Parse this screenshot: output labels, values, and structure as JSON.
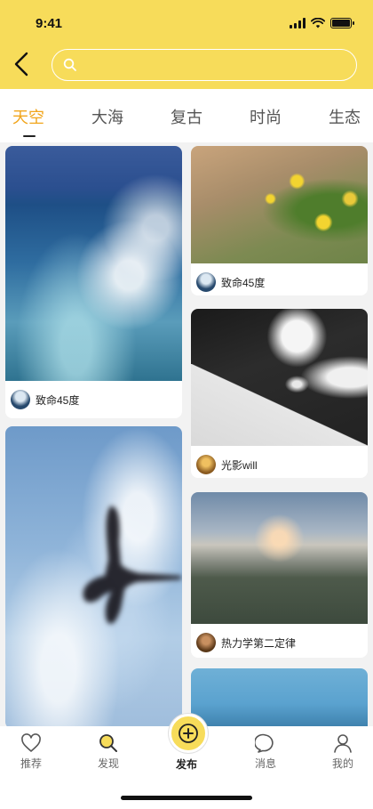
{
  "status_bar": {
    "time": "9:41"
  },
  "search": {
    "placeholder": "",
    "value": ""
  },
  "tabs": [
    {
      "label": "天空",
      "active": true
    },
    {
      "label": "大海",
      "active": false
    },
    {
      "label": "复古",
      "active": false
    },
    {
      "label": "时尚",
      "active": false
    },
    {
      "label": "生态",
      "active": false
    }
  ],
  "feed": {
    "left": [
      {
        "author": "致命45度",
        "photo": "ocean"
      },
      {
        "author": "",
        "photo": "sky-windmill"
      }
    ],
    "right": [
      {
        "author": "致命45度",
        "photo": "yellow-flowers"
      },
      {
        "author": "光影will",
        "photo": "building-clouds"
      },
      {
        "author": "热力学第二定律",
        "photo": "city-sunset"
      },
      {
        "author": "",
        "photo": "sea"
      }
    ]
  },
  "bottom_nav": {
    "items": [
      {
        "label": "推荐",
        "icon": "heart-icon"
      },
      {
        "label": "发现",
        "icon": "search-icon"
      },
      {
        "label": "发布",
        "icon": "plus-icon"
      },
      {
        "label": "消息",
        "icon": "chat-icon"
      },
      {
        "label": "我的",
        "icon": "user-icon"
      }
    ]
  },
  "colors": {
    "brand_yellow": "#f7dc5a",
    "active_tab": "#f1a51c"
  }
}
